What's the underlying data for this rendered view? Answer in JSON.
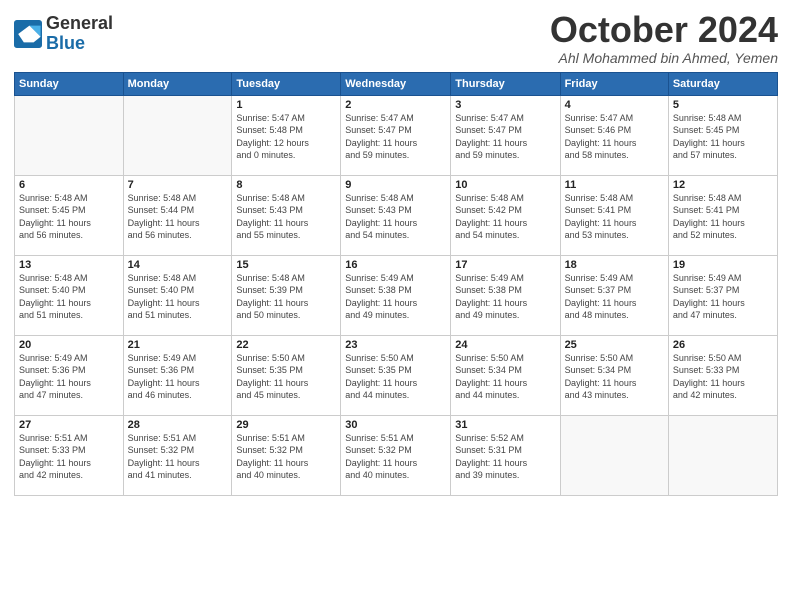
{
  "header": {
    "logo_general": "General",
    "logo_blue": "Blue",
    "month": "October 2024",
    "location": "Ahl Mohammed bin Ahmed, Yemen"
  },
  "days_of_week": [
    "Sunday",
    "Monday",
    "Tuesday",
    "Wednesday",
    "Thursday",
    "Friday",
    "Saturday"
  ],
  "weeks": [
    [
      {
        "day": "",
        "info": ""
      },
      {
        "day": "",
        "info": ""
      },
      {
        "day": "1",
        "info": "Sunrise: 5:47 AM\nSunset: 5:48 PM\nDaylight: 12 hours\nand 0 minutes."
      },
      {
        "day": "2",
        "info": "Sunrise: 5:47 AM\nSunset: 5:47 PM\nDaylight: 11 hours\nand 59 minutes."
      },
      {
        "day": "3",
        "info": "Sunrise: 5:47 AM\nSunset: 5:47 PM\nDaylight: 11 hours\nand 59 minutes."
      },
      {
        "day": "4",
        "info": "Sunrise: 5:47 AM\nSunset: 5:46 PM\nDaylight: 11 hours\nand 58 minutes."
      },
      {
        "day": "5",
        "info": "Sunrise: 5:48 AM\nSunset: 5:45 PM\nDaylight: 11 hours\nand 57 minutes."
      }
    ],
    [
      {
        "day": "6",
        "info": "Sunrise: 5:48 AM\nSunset: 5:45 PM\nDaylight: 11 hours\nand 56 minutes."
      },
      {
        "day": "7",
        "info": "Sunrise: 5:48 AM\nSunset: 5:44 PM\nDaylight: 11 hours\nand 56 minutes."
      },
      {
        "day": "8",
        "info": "Sunrise: 5:48 AM\nSunset: 5:43 PM\nDaylight: 11 hours\nand 55 minutes."
      },
      {
        "day": "9",
        "info": "Sunrise: 5:48 AM\nSunset: 5:43 PM\nDaylight: 11 hours\nand 54 minutes."
      },
      {
        "day": "10",
        "info": "Sunrise: 5:48 AM\nSunset: 5:42 PM\nDaylight: 11 hours\nand 54 minutes."
      },
      {
        "day": "11",
        "info": "Sunrise: 5:48 AM\nSunset: 5:41 PM\nDaylight: 11 hours\nand 53 minutes."
      },
      {
        "day": "12",
        "info": "Sunrise: 5:48 AM\nSunset: 5:41 PM\nDaylight: 11 hours\nand 52 minutes."
      }
    ],
    [
      {
        "day": "13",
        "info": "Sunrise: 5:48 AM\nSunset: 5:40 PM\nDaylight: 11 hours\nand 51 minutes."
      },
      {
        "day": "14",
        "info": "Sunrise: 5:48 AM\nSunset: 5:40 PM\nDaylight: 11 hours\nand 51 minutes."
      },
      {
        "day": "15",
        "info": "Sunrise: 5:48 AM\nSunset: 5:39 PM\nDaylight: 11 hours\nand 50 minutes."
      },
      {
        "day": "16",
        "info": "Sunrise: 5:49 AM\nSunset: 5:38 PM\nDaylight: 11 hours\nand 49 minutes."
      },
      {
        "day": "17",
        "info": "Sunrise: 5:49 AM\nSunset: 5:38 PM\nDaylight: 11 hours\nand 49 minutes."
      },
      {
        "day": "18",
        "info": "Sunrise: 5:49 AM\nSunset: 5:37 PM\nDaylight: 11 hours\nand 48 minutes."
      },
      {
        "day": "19",
        "info": "Sunrise: 5:49 AM\nSunset: 5:37 PM\nDaylight: 11 hours\nand 47 minutes."
      }
    ],
    [
      {
        "day": "20",
        "info": "Sunrise: 5:49 AM\nSunset: 5:36 PM\nDaylight: 11 hours\nand 47 minutes."
      },
      {
        "day": "21",
        "info": "Sunrise: 5:49 AM\nSunset: 5:36 PM\nDaylight: 11 hours\nand 46 minutes."
      },
      {
        "day": "22",
        "info": "Sunrise: 5:50 AM\nSunset: 5:35 PM\nDaylight: 11 hours\nand 45 minutes."
      },
      {
        "day": "23",
        "info": "Sunrise: 5:50 AM\nSunset: 5:35 PM\nDaylight: 11 hours\nand 44 minutes."
      },
      {
        "day": "24",
        "info": "Sunrise: 5:50 AM\nSunset: 5:34 PM\nDaylight: 11 hours\nand 44 minutes."
      },
      {
        "day": "25",
        "info": "Sunrise: 5:50 AM\nSunset: 5:34 PM\nDaylight: 11 hours\nand 43 minutes."
      },
      {
        "day": "26",
        "info": "Sunrise: 5:50 AM\nSunset: 5:33 PM\nDaylight: 11 hours\nand 42 minutes."
      }
    ],
    [
      {
        "day": "27",
        "info": "Sunrise: 5:51 AM\nSunset: 5:33 PM\nDaylight: 11 hours\nand 42 minutes."
      },
      {
        "day": "28",
        "info": "Sunrise: 5:51 AM\nSunset: 5:32 PM\nDaylight: 11 hours\nand 41 minutes."
      },
      {
        "day": "29",
        "info": "Sunrise: 5:51 AM\nSunset: 5:32 PM\nDaylight: 11 hours\nand 40 minutes."
      },
      {
        "day": "30",
        "info": "Sunrise: 5:51 AM\nSunset: 5:32 PM\nDaylight: 11 hours\nand 40 minutes."
      },
      {
        "day": "31",
        "info": "Sunrise: 5:52 AM\nSunset: 5:31 PM\nDaylight: 11 hours\nand 39 minutes."
      },
      {
        "day": "",
        "info": ""
      },
      {
        "day": "",
        "info": ""
      }
    ]
  ]
}
